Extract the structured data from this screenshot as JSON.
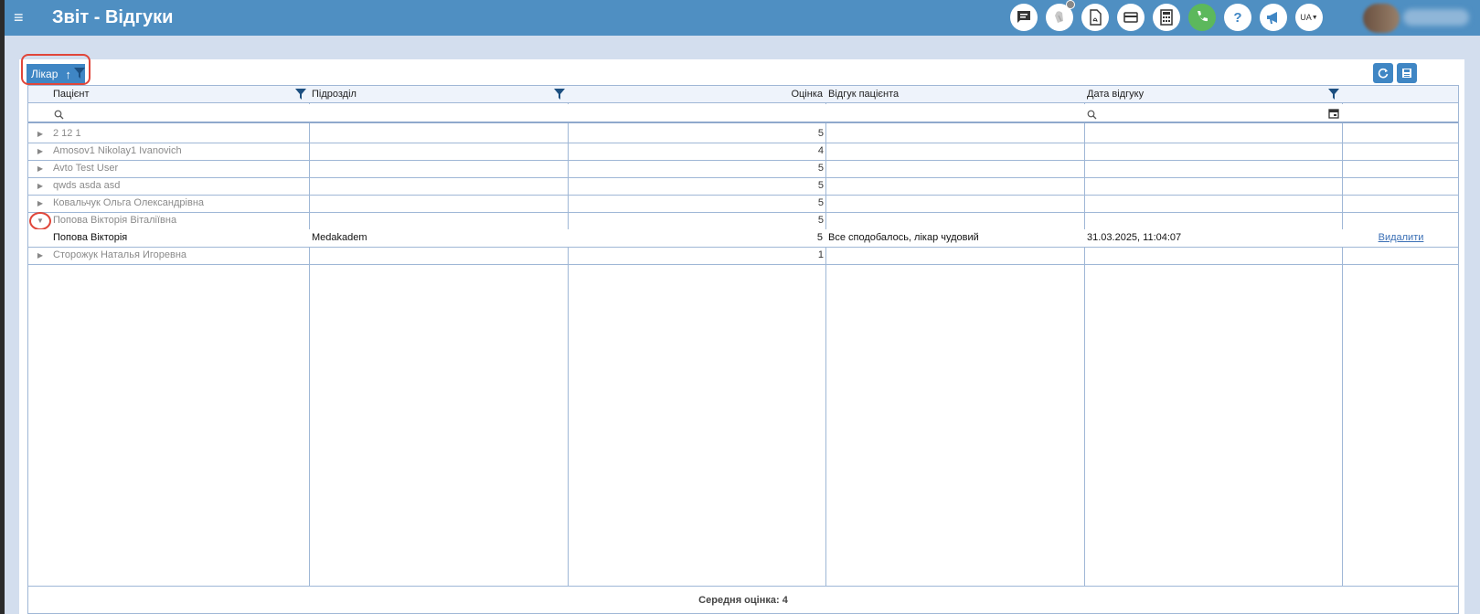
{
  "app": {
    "title": "Звіт - Відгуки",
    "brand_color": "#4f8fc2",
    "language": "UA"
  },
  "topbar_icons": [
    "chat-icon",
    "notifications-icon",
    "pdf-icon",
    "card-icon",
    "calculator-icon",
    "phone-icon",
    "help-icon",
    "announcement-icon"
  ],
  "group_panel": {
    "group_label": "Лікар",
    "sort_arrow": "↑"
  },
  "grid": {
    "columns": [
      "Пацієнт",
      "Підрозділ",
      "Оцінка",
      "Відгук пацієнта",
      "Дата відгуку"
    ],
    "groups": [
      {
        "name": "2 12 1",
        "score": "5"
      },
      {
        "name": "Amosov1 Nikolay1 Ivanovich",
        "score": "4"
      },
      {
        "name": "Avto Test User",
        "score": "5"
      },
      {
        "name": "qwds asda asd",
        "score": "5"
      },
      {
        "name": "Ковальчук Ольга Олександрівна",
        "score": "5"
      },
      {
        "name": "Попова Вікторія Віталіївна",
        "score": "5"
      },
      {
        "name": "Сторожук Наталья Игоревна",
        "score": "1"
      }
    ],
    "detail_row": {
      "patient": "Попова Вікторія",
      "department": "Medakadem",
      "score": "5",
      "review": "Все сподобалось, лікар чудовий",
      "date": "31.03.2025, 11:04:07",
      "action": "Видалити"
    }
  },
  "footer": {
    "average_label": "Середня оцінка: 4"
  }
}
